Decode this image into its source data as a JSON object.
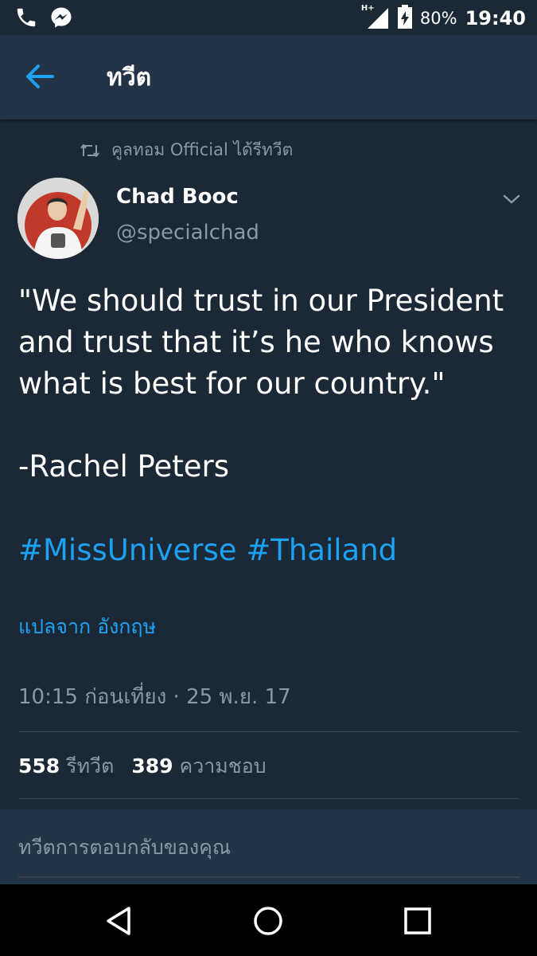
{
  "status_bar": {
    "network": "H+",
    "battery": "80%",
    "time": "19:40"
  },
  "app_bar": {
    "title": "ทวีต"
  },
  "tweet": {
    "retweeted_by": "คูลทอม Official ได้รีทวีต",
    "author_name": "Chad Booc",
    "author_handle": "@specialchad",
    "text_lines": [
      "\"We should trust in our President",
      "and trust that it’s he who knows",
      "what is best for our country.\""
    ],
    "attribution": "-Rachel Peters",
    "hashtags": [
      "#MissUniverse",
      "#Thailand"
    ],
    "translate_label": "แปลจาก อังกฤษ",
    "timestamp": "10:15 ก่อนเที่ยง · 25 พ.ย. 17",
    "retweet_count": "558",
    "retweet_label": "รีทวีต",
    "like_count": "389",
    "like_label": "ความชอบ"
  },
  "reply": {
    "placeholder": "ทวีตการตอบกลับของคุณ"
  },
  "colors": {
    "background": "#1b2836",
    "app_bar": "#243447",
    "accent": "#1da1f2",
    "secondary_text": "#8899a6"
  }
}
